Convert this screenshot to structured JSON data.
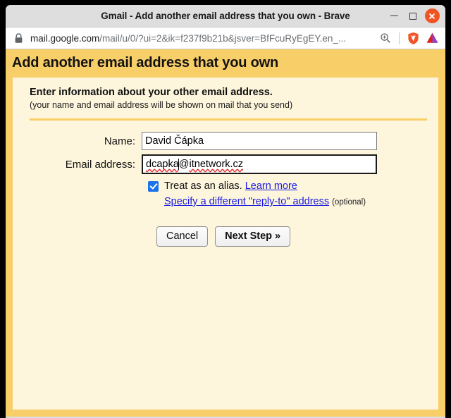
{
  "window": {
    "title": "Gmail - Add another email address that you own - Brave",
    "controls": {
      "minimize": "minimize",
      "maximize": "maximize",
      "close": "close"
    }
  },
  "toolbar": {
    "lock_icon": "lock-icon",
    "url_host": "mail.google.com",
    "url_path": "/mail/u/0/?ui=2&ik=f237f9b21b&jsver=BfFcuRyEgEY.en_...",
    "zoom_icon": "zoom-search-icon",
    "shield_icon": "brave-shield-lion-icon",
    "brave_logo": "brave-logo-icon"
  },
  "page": {
    "title": "Add another email address that you own",
    "section_title": "Enter information about your other email address.",
    "section_subtitle": "(your name and email address will be shown on mail that you send)"
  },
  "form": {
    "name_label": "Name:",
    "name_value": "David Čápka",
    "email_label": "Email address:",
    "email_value_before_caret": "dcapka",
    "email_value_at": "@",
    "email_value_domain": "itnetwork.cz",
    "email_value_full": "dcapka@itnetwork.cz",
    "alias_checked": true,
    "alias_label": "Treat as an alias.",
    "learn_more_label": "Learn more",
    "replyto_label": "Specify a different \"reply-to\" address",
    "optional_label": "(optional)",
    "cancel_label": "Cancel",
    "next_label": "Next Step »"
  },
  "colors": {
    "header_band": "#f7ce68",
    "page_background": "#fdf6dd",
    "link": "#1a1ae0",
    "checkbox_accent": "#1a73e8",
    "close_button": "#f05423",
    "spellcheck_underline": "#e8302a"
  }
}
